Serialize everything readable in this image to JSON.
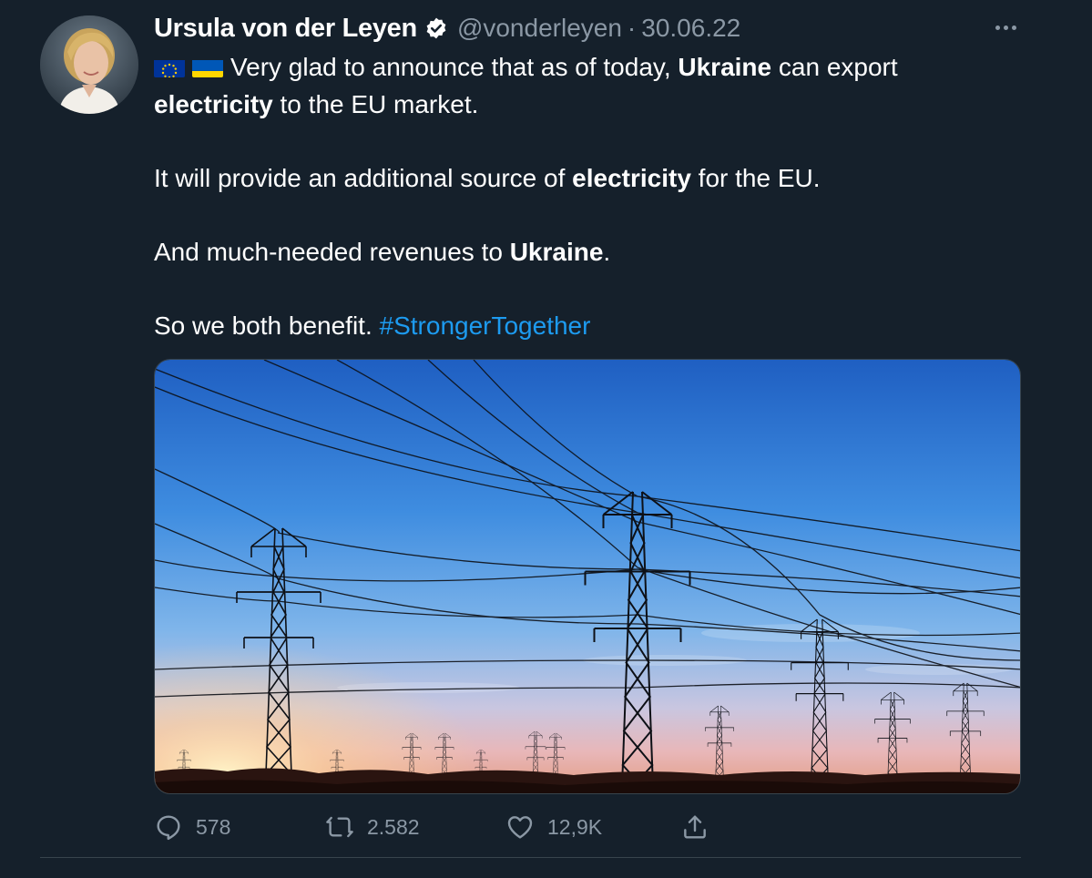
{
  "tweet": {
    "author": {
      "name": "Ursula von der Leyen",
      "handle": "@vonderleyen",
      "verified": true,
      "avatar_icon": "profile-photo"
    },
    "separator": "·",
    "date": "30.06.22",
    "text": {
      "line1_part1": "Very glad to announce that as of today, ",
      "line1_bold1": "Ukraine",
      "line1_part2": " can export",
      "line2_bold": "electricity",
      "line2_part": " to the EU market.",
      "para2_part1": "It will provide an additional source of ",
      "para2_bold": "electricity",
      "para2_part2": " for the EU.",
      "para3_part1": "And much-needed revenues to ",
      "para3_bold": "Ukraine",
      "para3_part2": ".",
      "para4_part1": "So we both benefit. ",
      "hashtag": "#StrongerTogether"
    },
    "flags": [
      "eu-flag",
      "ukraine-flag"
    ],
    "media": {
      "type": "photo",
      "subject": "electricity pylons and power lines at sunset"
    },
    "actions": {
      "replies": "578",
      "retweets": "2.582",
      "likes": "12,9K"
    }
  },
  "colors": {
    "background": "#15202b",
    "text": "#ffffff",
    "muted": "#8b98a5",
    "link": "#1d9bf0",
    "divider": "#38444d"
  }
}
